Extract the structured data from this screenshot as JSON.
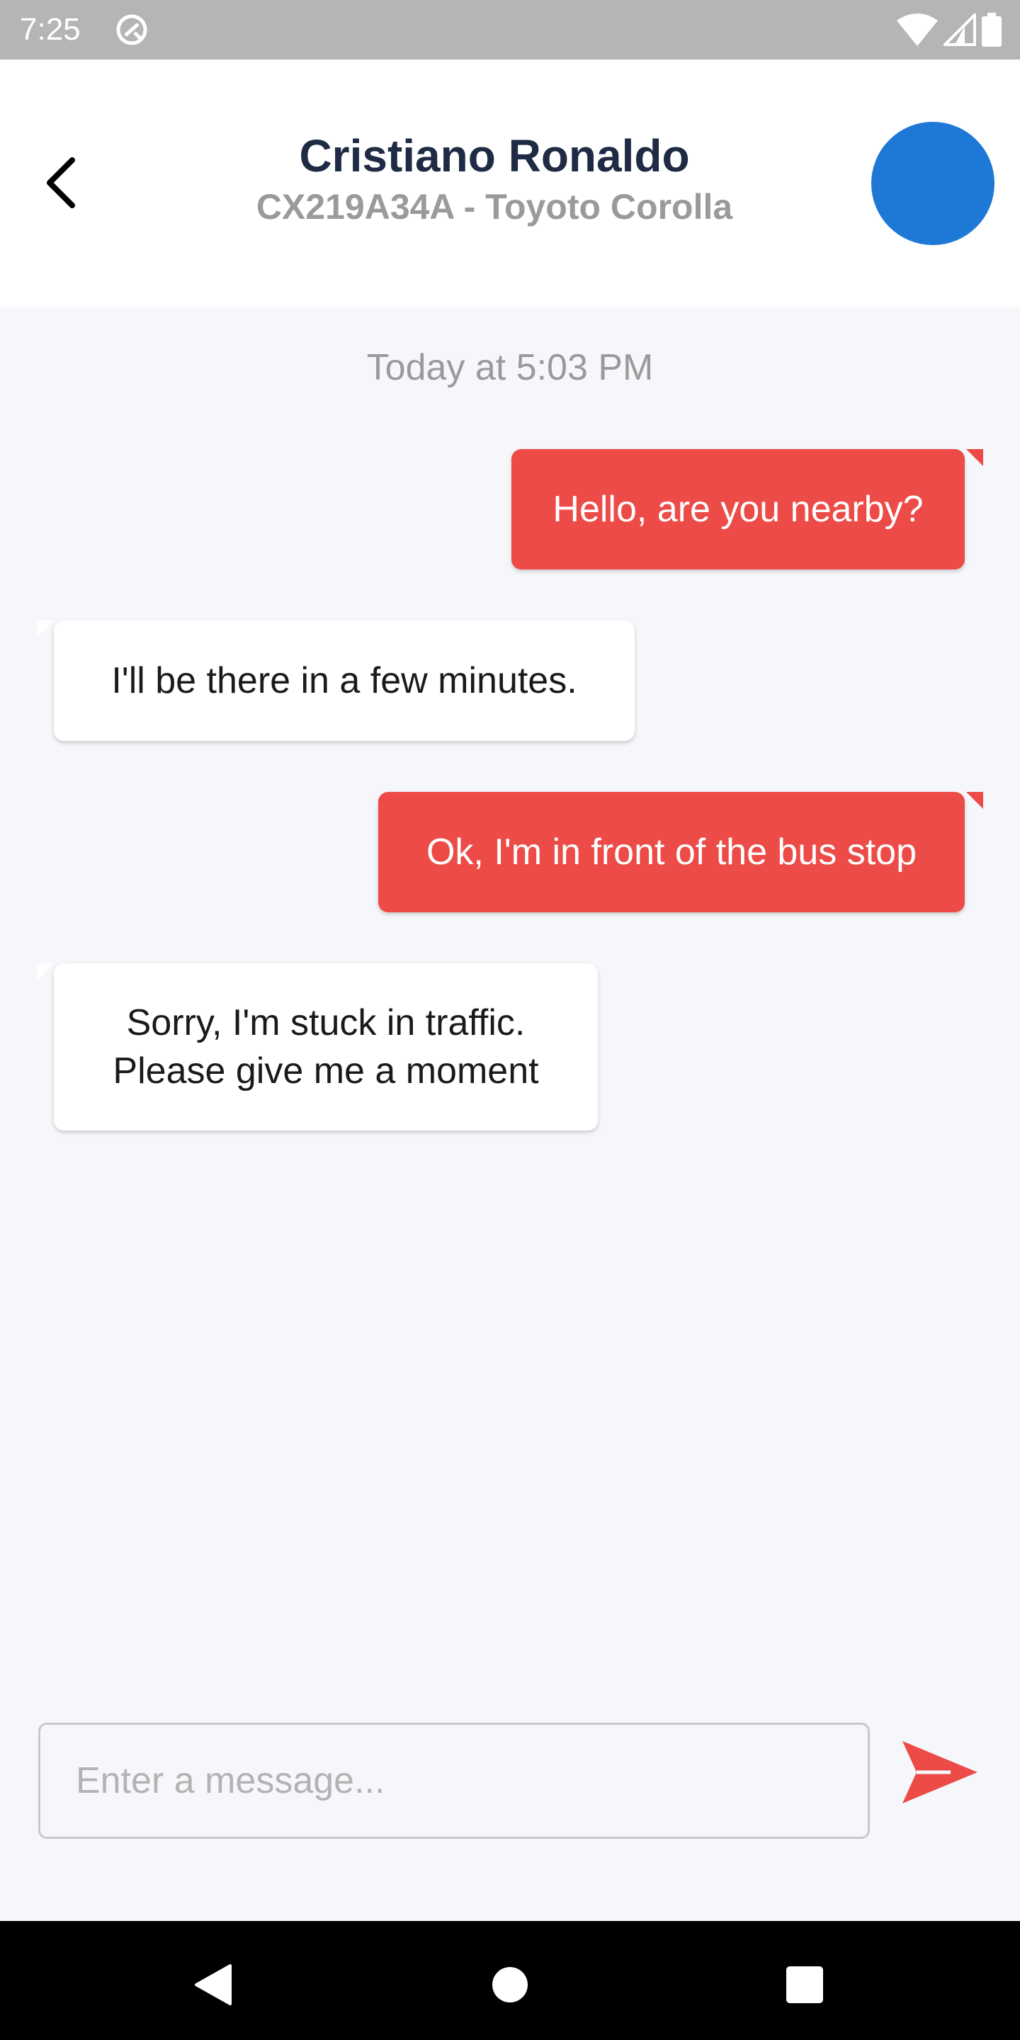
{
  "status_bar": {
    "time": "7:25",
    "icons": [
      "sync-icon",
      "wifi-icon",
      "signal-icon",
      "battery-icon"
    ]
  },
  "header": {
    "back_icon": "chevron-left-icon",
    "contact_name": "Cristiano Ronaldo",
    "vehicle_info": "CX219A34A - Toyoto Corolla",
    "avatar_color": "#1e78d6"
  },
  "chat": {
    "timestamp": "Today at 5:03 PM",
    "messages": [
      {
        "direction": "outgoing",
        "text": "Hello, are you nearby?"
      },
      {
        "direction": "incoming",
        "text": "I'll be there in a few minutes."
      },
      {
        "direction": "outgoing",
        "text": "Ok, I'm in front of the bus stop"
      },
      {
        "direction": "incoming",
        "text": "Sorry, I'm stuck in traffic.\n Please give me a moment"
      }
    ]
  },
  "composer": {
    "placeholder": "Enter a message...",
    "value": "",
    "send_icon": "send-icon"
  },
  "nav_bar": {
    "buttons": [
      "back-triangle-icon",
      "home-circle-icon",
      "recents-square-icon"
    ]
  },
  "colors": {
    "accent": "#ec4b47",
    "title": "#1f2a44",
    "muted": "#9a9a9a",
    "background": "#f6f7fb"
  }
}
